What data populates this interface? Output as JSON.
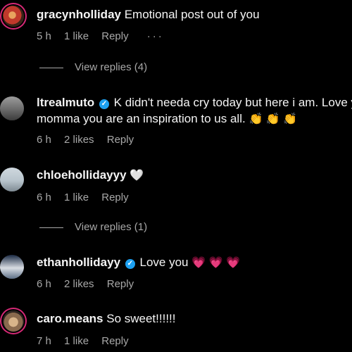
{
  "comments": [
    {
      "username": "gracynholliday",
      "text": "Emotional post out of you",
      "time": "5 h",
      "likes": "1 like",
      "reply": "Reply",
      "more": "···",
      "view_replies": "View replies (4)"
    },
    {
      "username": "ltrealmuto",
      "verified": true,
      "text_line1": "K didn't needa cry today but here i am. Love y",
      "text_line2": "momma you are an inspiration to us all.",
      "emojis": "👏 👏 👏",
      "time": "6 h",
      "likes": "2 likes",
      "reply": "Reply"
    },
    {
      "username": "chloehollidayyy",
      "emoji": "🤍",
      "time": "6 h",
      "likes": "1 like",
      "reply": "Reply",
      "view_replies": "View replies (1)"
    },
    {
      "username": "ethanhollidayy",
      "verified": true,
      "text": "Love you",
      "emojis": "💗 💗 💗",
      "time": "6 h",
      "likes": "2 likes",
      "reply": "Reply"
    },
    {
      "username": "caro.means",
      "text": "So sweet!!!!!!",
      "time": "7 h",
      "likes": "1 like",
      "reply": "Reply"
    }
  ]
}
